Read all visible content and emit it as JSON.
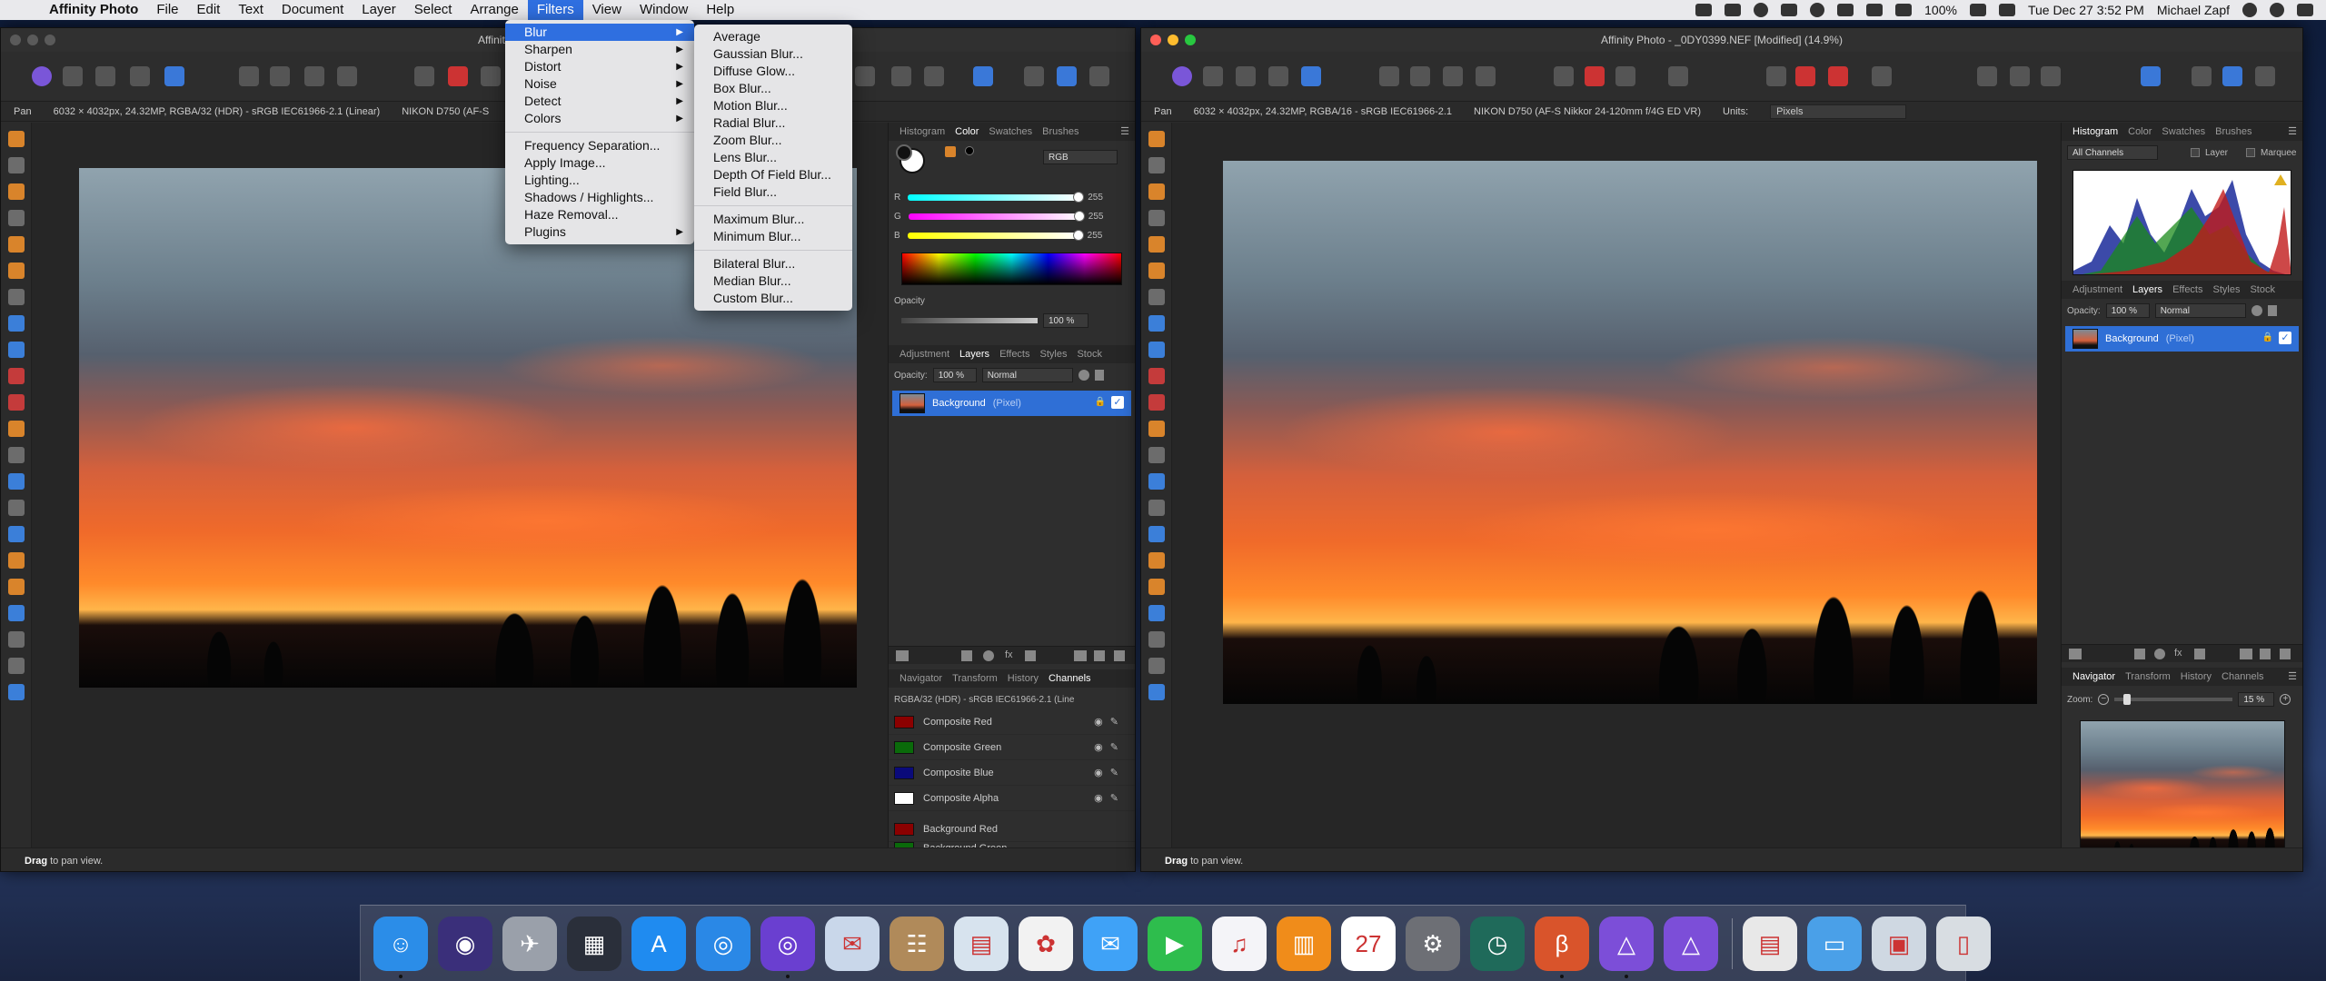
{
  "menubar": {
    "app": "Affinity Photo",
    "items": [
      "File",
      "Edit",
      "Text",
      "Document",
      "Layer",
      "Select",
      "Arrange",
      "Filters",
      "View",
      "Window",
      "Help"
    ],
    "active": "Filters",
    "status": {
      "battery": "100%",
      "datetime": "Tue Dec 27  3:52 PM",
      "user": "Michael Zapf"
    }
  },
  "filters_menu": {
    "items": [
      {
        "label": "Blur",
        "submenu": true
      },
      {
        "label": "Sharpen",
        "submenu": true
      },
      {
        "label": "Distort",
        "submenu": true
      },
      {
        "label": "Noise",
        "submenu": true
      },
      {
        "label": "Detect",
        "submenu": true
      },
      {
        "label": "Colors",
        "submenu": true
      },
      {
        "label": "Frequency Separation...",
        "submenu": false
      },
      {
        "label": "Apply Image...",
        "submenu": false
      },
      {
        "label": "Lighting...",
        "submenu": false
      },
      {
        "label": "Shadows / Highlights...",
        "submenu": false
      },
      {
        "label": "Haze Removal...",
        "submenu": false
      },
      {
        "label": "Plugins",
        "submenu": true
      }
    ]
  },
  "blur_submenu": {
    "group1": [
      "Average",
      "Gaussian Blur...",
      "Diffuse Glow...",
      "Box Blur...",
      "Motion Blur...",
      "Radial Blur...",
      "Zoom Blur...",
      "Lens Blur...",
      "Depth Of Field Blur...",
      "Field Blur..."
    ],
    "group2": [
      "Maximum Blur...",
      "Minimum Blur..."
    ],
    "group3": [
      "Bilateral Blur...",
      "Median Blur...",
      "Custom Blur..."
    ]
  },
  "left_window": {
    "title": "Affinity Photo",
    "context": {
      "tool": "Pan",
      "doc_info": "6032 × 4032px, 24.32MP, RGBA/32 (HDR) - sRGB IEC61966-2.1 (Linear)",
      "camera": "NIKON D750 (AF-S"
    },
    "status": {
      "bold": "Drag",
      "rest": " to pan view."
    },
    "color_panel": {
      "tabs": [
        "Histogram",
        "Color",
        "Swatches",
        "Brushes"
      ],
      "active_tab": "Color",
      "mode": "RGB",
      "r_label": "R",
      "r": "255",
      "g_label": "G",
      "g": "255",
      "b_label": "B",
      "b": "255",
      "opacity_label": "Opacity",
      "opacity": "100 %"
    },
    "layers_panel": {
      "tabs": [
        "Adjustment",
        "Layers",
        "Effects",
        "Styles",
        "Stock"
      ],
      "active_tab": "Layers",
      "opacity_label": "Opacity:",
      "opacity": "100 %",
      "blend": "Normal",
      "layer_name": "Background",
      "layer_type": "(Pixel)"
    },
    "channels_panel": {
      "tabs": [
        "Navigator",
        "Transform",
        "History",
        "Channels"
      ],
      "active_tab": "Channels",
      "profile": "RGBA/32 (HDR) - sRGB IEC61966-2.1 (Line",
      "channels": [
        {
          "name": "Composite Red",
          "color": "#8b0000"
        },
        {
          "name": "Composite Green",
          "color": "#0a6a0a"
        },
        {
          "name": "Composite Blue",
          "color": "#0a0a7a"
        },
        {
          "name": "Composite Alpha",
          "color": "#ffffff"
        },
        {
          "name": "Background Red",
          "color": "#8b0000"
        },
        {
          "name": "Background Green",
          "color": "#0a6a0a"
        }
      ]
    }
  },
  "right_window": {
    "title": "Affinity Photo - _0DY0399.NEF [Modified] (14.9%)",
    "context": {
      "tool": "Pan",
      "doc_info": "6032 × 4032px, 24.32MP, RGBA/16 - sRGB IEC61966-2.1",
      "camera": "NIKON D750 (AF-S Nikkor 24-120mm f/4G ED VR)",
      "units_label": "Units:",
      "units": "Pixels"
    },
    "status": {
      "bold": "Drag",
      "rest": " to pan view."
    },
    "histogram_panel": {
      "tabs": [
        "Histogram",
        "Color",
        "Swatches",
        "Brushes"
      ],
      "active_tab": "Histogram",
      "channel_select": "All Channels",
      "layer_label": "Layer",
      "marquee_label": "Marquee"
    },
    "layers_panel": {
      "tabs": [
        "Adjustment",
        "Layers",
        "Effects",
        "Styles",
        "Stock"
      ],
      "active_tab": "Layers",
      "opacity_label": "Opacity:",
      "opacity": "100 %",
      "blend": "Normal",
      "layer_name": "Background",
      "layer_type": "(Pixel)"
    },
    "navigator_panel": {
      "tabs": [
        "Navigator",
        "Transform",
        "History",
        "Channels"
      ],
      "active_tab": "Navigator",
      "zoom_label": "Zoom:",
      "zoom": "15 %"
    }
  },
  "dock": {
    "apps": [
      {
        "name": "Finder",
        "color": "#2b8de8",
        "glyph": "☺"
      },
      {
        "name": "Siri",
        "color": "#3a2f7a",
        "glyph": "◉"
      },
      {
        "name": "Launchpad",
        "color": "#9aa0aa",
        "glyph": "✈"
      },
      {
        "name": "Mission Control",
        "color": "#2a2f3a",
        "glyph": "▦"
      },
      {
        "name": "App Store",
        "color": "#1f8bf0",
        "glyph": "A"
      },
      {
        "name": "Safari",
        "color": "#2a88e6",
        "glyph": "◎"
      },
      {
        "name": "Safari Technology Preview",
        "color": "#6a3fd0",
        "glyph": "◎"
      },
      {
        "name": "Mail",
        "color": "#c9d7ea",
        "glyph": "✉"
      },
      {
        "name": "Contacts",
        "color": "#b08a5a",
        "glyph": "☷"
      },
      {
        "name": "Preview",
        "color": "#d7e3ee",
        "glyph": "▤"
      },
      {
        "name": "Photos",
        "color": "#f2f2f2",
        "glyph": "✿"
      },
      {
        "name": "Messages",
        "color": "#3fa2f7",
        "glyph": "✉"
      },
      {
        "name": "FaceTime",
        "color": "#2ebd4d",
        "glyph": "▶"
      },
      {
        "name": "iTunes",
        "color": "#f4f4f8",
        "glyph": "♫"
      },
      {
        "name": "iBooks",
        "color": "#f08c1a",
        "glyph": "▥"
      },
      {
        "name": "Calendar",
        "color": "#ffffff",
        "glyph": "27"
      },
      {
        "name": "System Preferences",
        "color": "#6d6f75",
        "glyph": "⚙"
      },
      {
        "name": "Time Machine",
        "color": "#1f6a5a",
        "glyph": "◷"
      },
      {
        "name": "Affinity Photo Beta",
        "color": "#d9542b",
        "glyph": "β"
      },
      {
        "name": "Affinity Photo",
        "color": "#7c4ed8",
        "glyph": "△"
      },
      {
        "name": "Affinity Designer",
        "color": "#7c4ed8",
        "glyph": "△"
      },
      {
        "name": "Document",
        "color": "#e8e8e8",
        "glyph": "▤"
      },
      {
        "name": "Folder",
        "color": "#4aa0e8",
        "glyph": "▭"
      },
      {
        "name": "Screenshot",
        "color": "#cfd8e2",
        "glyph": "▣"
      },
      {
        "name": "Trash",
        "color": "#d8dde2",
        "glyph": "▯"
      }
    ]
  }
}
